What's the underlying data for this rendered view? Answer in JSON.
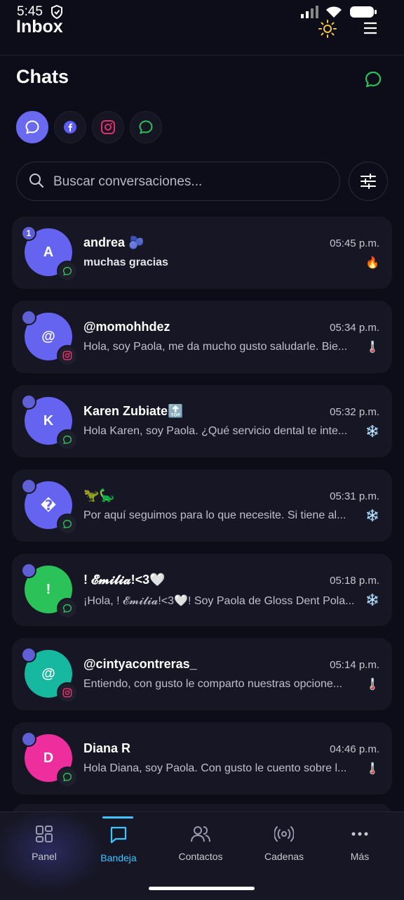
{
  "status": {
    "time": "5:45"
  },
  "app": {
    "title": "Inbox"
  },
  "chats": {
    "title": "Chats"
  },
  "channels": [
    "all",
    "facebook",
    "instagram",
    "whatsapp"
  ],
  "search": {
    "placeholder": "Buscar conversaciones..."
  },
  "conversations": [
    {
      "name": "andrea 🫐",
      "time": "05:45 p.m.",
      "preview": "muchas gracias",
      "temp": "🔥",
      "initial": "A",
      "color": "#6464f0",
      "channel": "whatsapp",
      "unread": "1"
    },
    {
      "name": "@momohhdez",
      "time": "05:34 p.m.",
      "preview": "Hola, soy Paola, me da mucho gusto saludarle. Bie...",
      "temp": "🌡️",
      "initial": "@",
      "color": "#6464f0",
      "channel": "instagram",
      "unread": ""
    },
    {
      "name": "Karen Zubiate🔝",
      "time": "05:32 p.m.",
      "preview": "Hola Karen, soy Paola. ¿Qué servicio dental te inte...",
      "temp": "❄️",
      "initial": "K",
      "color": "#6464f0",
      "channel": "whatsapp",
      "unread": ""
    },
    {
      "name": "🦖🦕",
      "time": "05:31 p.m.",
      "preview": "Por aquí seguimos para lo que necesite. Si tiene al...",
      "temp": "❄️",
      "initial": "�",
      "color": "#6464f0",
      "channel": "whatsapp",
      "unread": ""
    },
    {
      "name": "! 𝓔𝓶𝓲𝓵𝓲𝓪!<3🤍",
      "time": "05:18 p.m.",
      "preview": "¡Hola, ! 𝓔𝓶𝓲𝓵𝓲𝓪!<3🤍! Soy Paola de Gloss Dent Pola...",
      "temp": "❄️",
      "initial": "!",
      "color": "#2cc25a",
      "channel": "whatsapp",
      "unread": ""
    },
    {
      "name": "@cintyacontreras_",
      "time": "05:14 p.m.",
      "preview": "Entiendo, con gusto le comparto nuestras opcione...",
      "temp": "🌡️",
      "initial": "@",
      "color": "#17b8a0",
      "channel": "instagram",
      "unread": ""
    },
    {
      "name": "Diana R",
      "time": "04:46 p.m.",
      "preview": "Hola Diana, soy Paola. Con gusto le cuento sobre l...",
      "temp": "🌡️",
      "initial": "D",
      "color": "#ee2e9d",
      "channel": "whatsapp",
      "unread": ""
    }
  ],
  "nav": {
    "panel": "Panel",
    "bandeja": "Bandeja",
    "contactos": "Contactos",
    "cadenas": "Cadenas",
    "mas": "Más"
  },
  "colors": {
    "accent": "#6a6af0",
    "active_nav": "#3fc5ff",
    "whatsapp": "#2dbf5a",
    "instagram": "#e1306c",
    "background": "#0d0d19",
    "card": "#161624"
  }
}
